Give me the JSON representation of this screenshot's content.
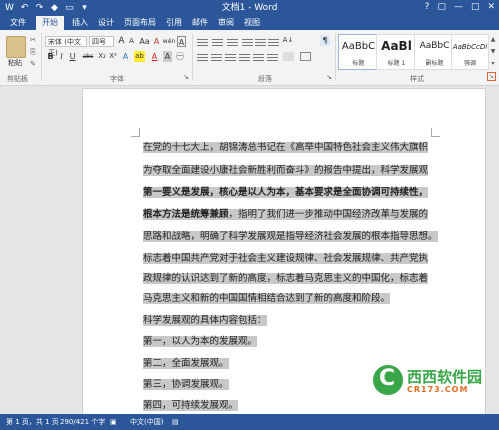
{
  "window": {
    "title": "文档1 - Word",
    "controls": [
      "?",
      "▢",
      "—",
      "□",
      "✕"
    ]
  },
  "qat": [
    "W",
    "↶",
    "↷",
    "◆",
    "▭",
    "▾"
  ],
  "tabs": [
    "文件",
    "开始",
    "插入",
    "设计",
    "页面布局",
    "引用",
    "邮件",
    "审阅",
    "视图"
  ],
  "ribbon": {
    "clipboard": {
      "paste_label": "粘贴",
      "group_label": "剪贴板"
    },
    "font": {
      "font_name": "宋体 (中文正)",
      "font_size": "四号",
      "grow": "A",
      "shrink": "A",
      "case": "Aa",
      "clear": "A",
      "wen": "wén",
      "char_border": "A",
      "bold": "B",
      "italic": "I",
      "underline": "U",
      "strike": "abc",
      "subscript": "X₂",
      "superscript": "X²",
      "color_a": "A",
      "highlight": "ab",
      "font_color": "A",
      "char_shade": "A",
      "circle": "㊀",
      "group_label": "字体"
    },
    "paragraph": {
      "group_label": "段落",
      "sort": "A↓",
      "show": "¶"
    },
    "styles": {
      "items": [
        {
          "sample": "AaBbC",
          "name": "标题"
        },
        {
          "sample": "AaBl",
          "name": "标题 1"
        },
        {
          "sample": "AaBbC",
          "name": "副标题"
        },
        {
          "sample": "AaBbCcDi",
          "name": "强调"
        }
      ],
      "group_label": "样式"
    }
  },
  "document": {
    "lines": [
      "在党的十七大上，胡锦涛总书记在《高举中国特色社会主义伟大旗帜",
      "为夺取全面建设小康社会新胜利而奋斗》的报告中提出，科学发展观",
      "第一要义是发展，核心是以人为本，基本要求是全面协调可持续性，",
      "根本方法是统筹兼顾",
      "，指明了我们进一步推动中国经济改革与发展的",
      "思路和战略，明确了科学发展观是指导经济社会发展的根本指导思想。",
      "标志着中国共产党对于社会主义建设规律、社会发展规律、共产党执",
      "政规律的认识达到了新的高度，标志着马克思主义的中国化，标志着",
      "马克思主义和新的中国国情相结合达到了新的高度和阶段。",
      "科学发展观的具体内容包括：",
      "第一，以人为本的发展观。",
      "第二，全面发展观。",
      "第三，协调发展观。",
      "第四，可持续发展观。"
    ]
  },
  "watermark": {
    "name": "西西软件园",
    "url": "CR173.COM"
  },
  "statusbar": {
    "page": "第 1 页，共 1 页",
    "words": "290/421 个字",
    "lang": "中文(中国)"
  },
  "colors": {
    "accent": "#2b579a",
    "highlight": "#c8c8c8",
    "logo_green": "#3aa64a",
    "logo_orange": "#e36b22"
  }
}
